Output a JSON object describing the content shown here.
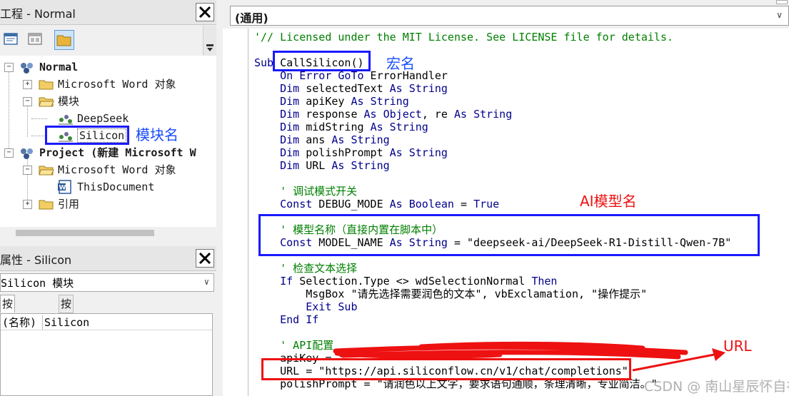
{
  "project_panel": {
    "title": "工程 - Normal",
    "tree": [
      {
        "label": "Normal"
      },
      {
        "label": "Microsoft Word 对象"
      },
      {
        "label": "模块"
      },
      {
        "label": "DeepSeek"
      },
      {
        "label": "Silicon"
      },
      {
        "label": "Project (新建 Microsoft W"
      },
      {
        "label": "Microsoft Word 对象"
      },
      {
        "label": "ThisDocument"
      },
      {
        "label": "引用"
      }
    ]
  },
  "properties_panel": {
    "title": "属性 - Silicon",
    "object_combo": "Silicon 模块",
    "tabs": [
      "按字母序",
      "按分类序"
    ],
    "rows": [
      {
        "key": "(名称)",
        "value": "Silicon"
      }
    ]
  },
  "code_pane": {
    "object_combo": "(通用)",
    "lines": [
      "'// Licensed under the MIT License. See LICENSE file for details.",
      "",
      "Sub CallSilicon()",
      "    On Error GoTo ErrorHandler",
      "    Dim selectedText As String",
      "    Dim apiKey As String",
      "    Dim response As Object, re As String",
      "    Dim midString As String",
      "    Dim ans As String",
      "    Dim polishPrompt As String",
      "    Dim URL As String",
      "",
      "    ' 调试模式开关",
      "    Const DEBUG_MODE As Boolean = True",
      "",
      "    ' 模型名称（直接内置在脚本中）",
      "    Const MODEL_NAME As String = \"deepseek-ai/DeepSeek-R1-Distill-Qwen-7B\"",
      "",
      "    ' 检查文本选择",
      "    If Selection.Type <> wdSelectionNormal Then",
      "        MsgBox \"请先选择需要润色的文本\", vbExclamation, \"操作提示\"",
      "        Exit Sub",
      "    End If",
      "",
      "    ' API配置",
      "    apiKey = \"",
      "    URL = \"https://api.siliconflow.cn/v1/chat/completions\"",
      "    polishPrompt = \"请润色以上文字，要求语句通顺，条理清晰，专业简洁。\""
    ]
  },
  "annotations": {
    "macro_name": "宏名",
    "module_name": "模块名",
    "ai_model_name": "AI模型名",
    "url": "URL"
  },
  "watermark": "CSDN @ 南山星辰怀自在",
  "colors": {
    "keyword": "#00008b",
    "comment": "#008000",
    "blue_annotation": "#1a1aff",
    "red_annotation": "#ee1111"
  }
}
